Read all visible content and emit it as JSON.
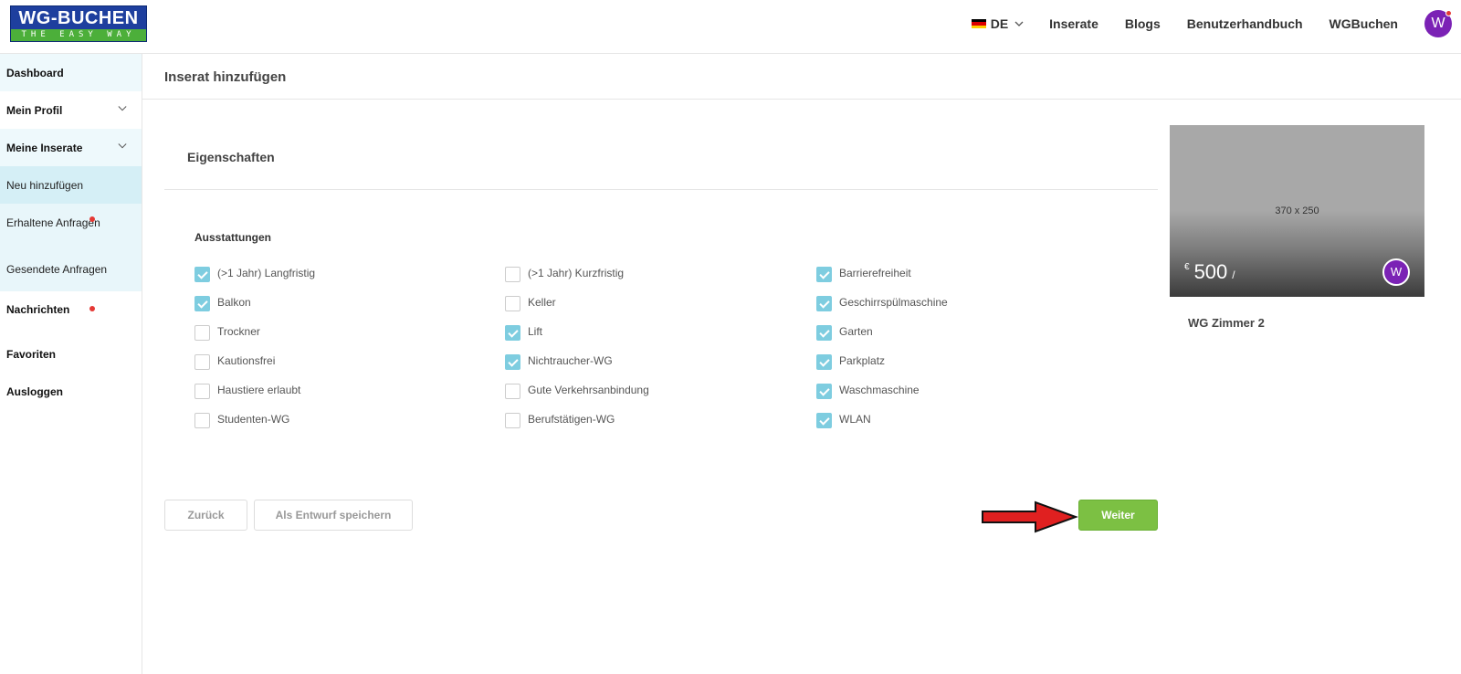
{
  "header": {
    "logo_top": "WG-BUCHEN",
    "logo_bottom": "THE EASY WAY",
    "lang": "DE",
    "nav": [
      "Inserate",
      "Blogs",
      "Benutzerhandbuch",
      "WGBuchen"
    ],
    "avatar": "W"
  },
  "sidebar": {
    "dashboard": "Dashboard",
    "mein_profil": "Mein Profil",
    "meine_inserate": "Meine Inserate",
    "neu_hinzufuegen": "Neu hinzufügen",
    "erhaltene_anfragen": "Erhaltene Anfragen",
    "gesendete_anfragen": "Gesendete Anfragen",
    "nachrichten": "Nachrichten",
    "favoriten": "Favoriten",
    "ausloggen": "Ausloggen"
  },
  "main": {
    "page_title": "Inserat hinzufügen",
    "section_title": "Eigenschaften",
    "group_title": "Ausstattungen",
    "amenities": [
      [
        {
          "label": "(>1 Jahr) Langfristig",
          "checked": true
        },
        {
          "label": "Balkon",
          "checked": true
        },
        {
          "label": "Trockner",
          "checked": false
        },
        {
          "label": "Kautionsfrei",
          "checked": false
        },
        {
          "label": "Haustiere erlaubt",
          "checked": false
        },
        {
          "label": "Studenten-WG",
          "checked": false
        }
      ],
      [
        {
          "label": "(>1 Jahr) Kurzfristig",
          "checked": false
        },
        {
          "label": "Keller",
          "checked": false
        },
        {
          "label": "Lift",
          "checked": true
        },
        {
          "label": "Nichtraucher-WG",
          "checked": true
        },
        {
          "label": "Gute Verkehrsanbindung",
          "checked": false
        },
        {
          "label": "Berufstätigen-WG",
          "checked": false
        }
      ],
      [
        {
          "label": "Barrierefreiheit",
          "checked": true
        },
        {
          "label": "Geschirrspülmaschine",
          "checked": true
        },
        {
          "label": "Garten",
          "checked": true
        },
        {
          "label": "Parkplatz",
          "checked": true
        },
        {
          "label": "Waschmaschine",
          "checked": true
        },
        {
          "label": "WLAN",
          "checked": true
        }
      ]
    ],
    "buttons": {
      "back": "Zurück",
      "draft": "Als Entwurf speichern",
      "next": "Weiter"
    }
  },
  "card": {
    "image_placeholder": "370 x 250",
    "currency": "€",
    "price": "500",
    "per": "/",
    "avatar": "W",
    "title": "WG Zimmer 2"
  },
  "colors": {
    "brand_blue": "#1e3f9e",
    "brand_green": "#4caf3a",
    "accent_purple": "#7b22b5",
    "checkbox_checked": "#7ecde0",
    "next_button": "#7cc043",
    "annotation_arrow": "#e02020"
  }
}
